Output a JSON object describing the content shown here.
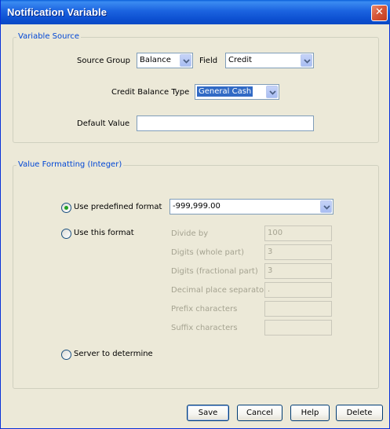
{
  "window": {
    "title": "Notification Variable",
    "close_glyph": "✕"
  },
  "variable_source": {
    "legend": "Variable Source",
    "source_group_label": "Source Group",
    "source_group_value": "Balance",
    "field_label": "Field",
    "field_value": "Credit",
    "credit_balance_type_label": "Credit Balance Type",
    "credit_balance_type_value": "General Cash",
    "default_value_label": "Default Value",
    "default_value": ""
  },
  "value_formatting": {
    "legend": "Value Formatting (Integer)",
    "use_predefined_label": "Use predefined format",
    "predefined_format_value": "-999,999.00",
    "use_this_format_label": "Use this format",
    "divide_by_label": "Divide by",
    "divide_by_value": "100",
    "digits_whole_label": "Digits (whole part)",
    "digits_whole_value": "3",
    "digits_fractional_label": "Digits (fractional part)",
    "digits_fractional_value": "3",
    "decimal_separator_label": "Decimal place separator",
    "decimal_separator_value": ".",
    "prefix_label": "Prefix characters",
    "prefix_value": "",
    "suffix_label": "Suffix characters",
    "suffix_value": "",
    "server_label": "Server to determine",
    "selected_option": "Use predefined format"
  },
  "buttons": {
    "save": "Save",
    "cancel": "Cancel",
    "help": "Help",
    "delete": "Delete"
  },
  "colors": {
    "title_bar": "#0c4fd0",
    "legend_text": "#0046d5",
    "selection": "#316ac5",
    "radio_selected": "#21a121"
  }
}
